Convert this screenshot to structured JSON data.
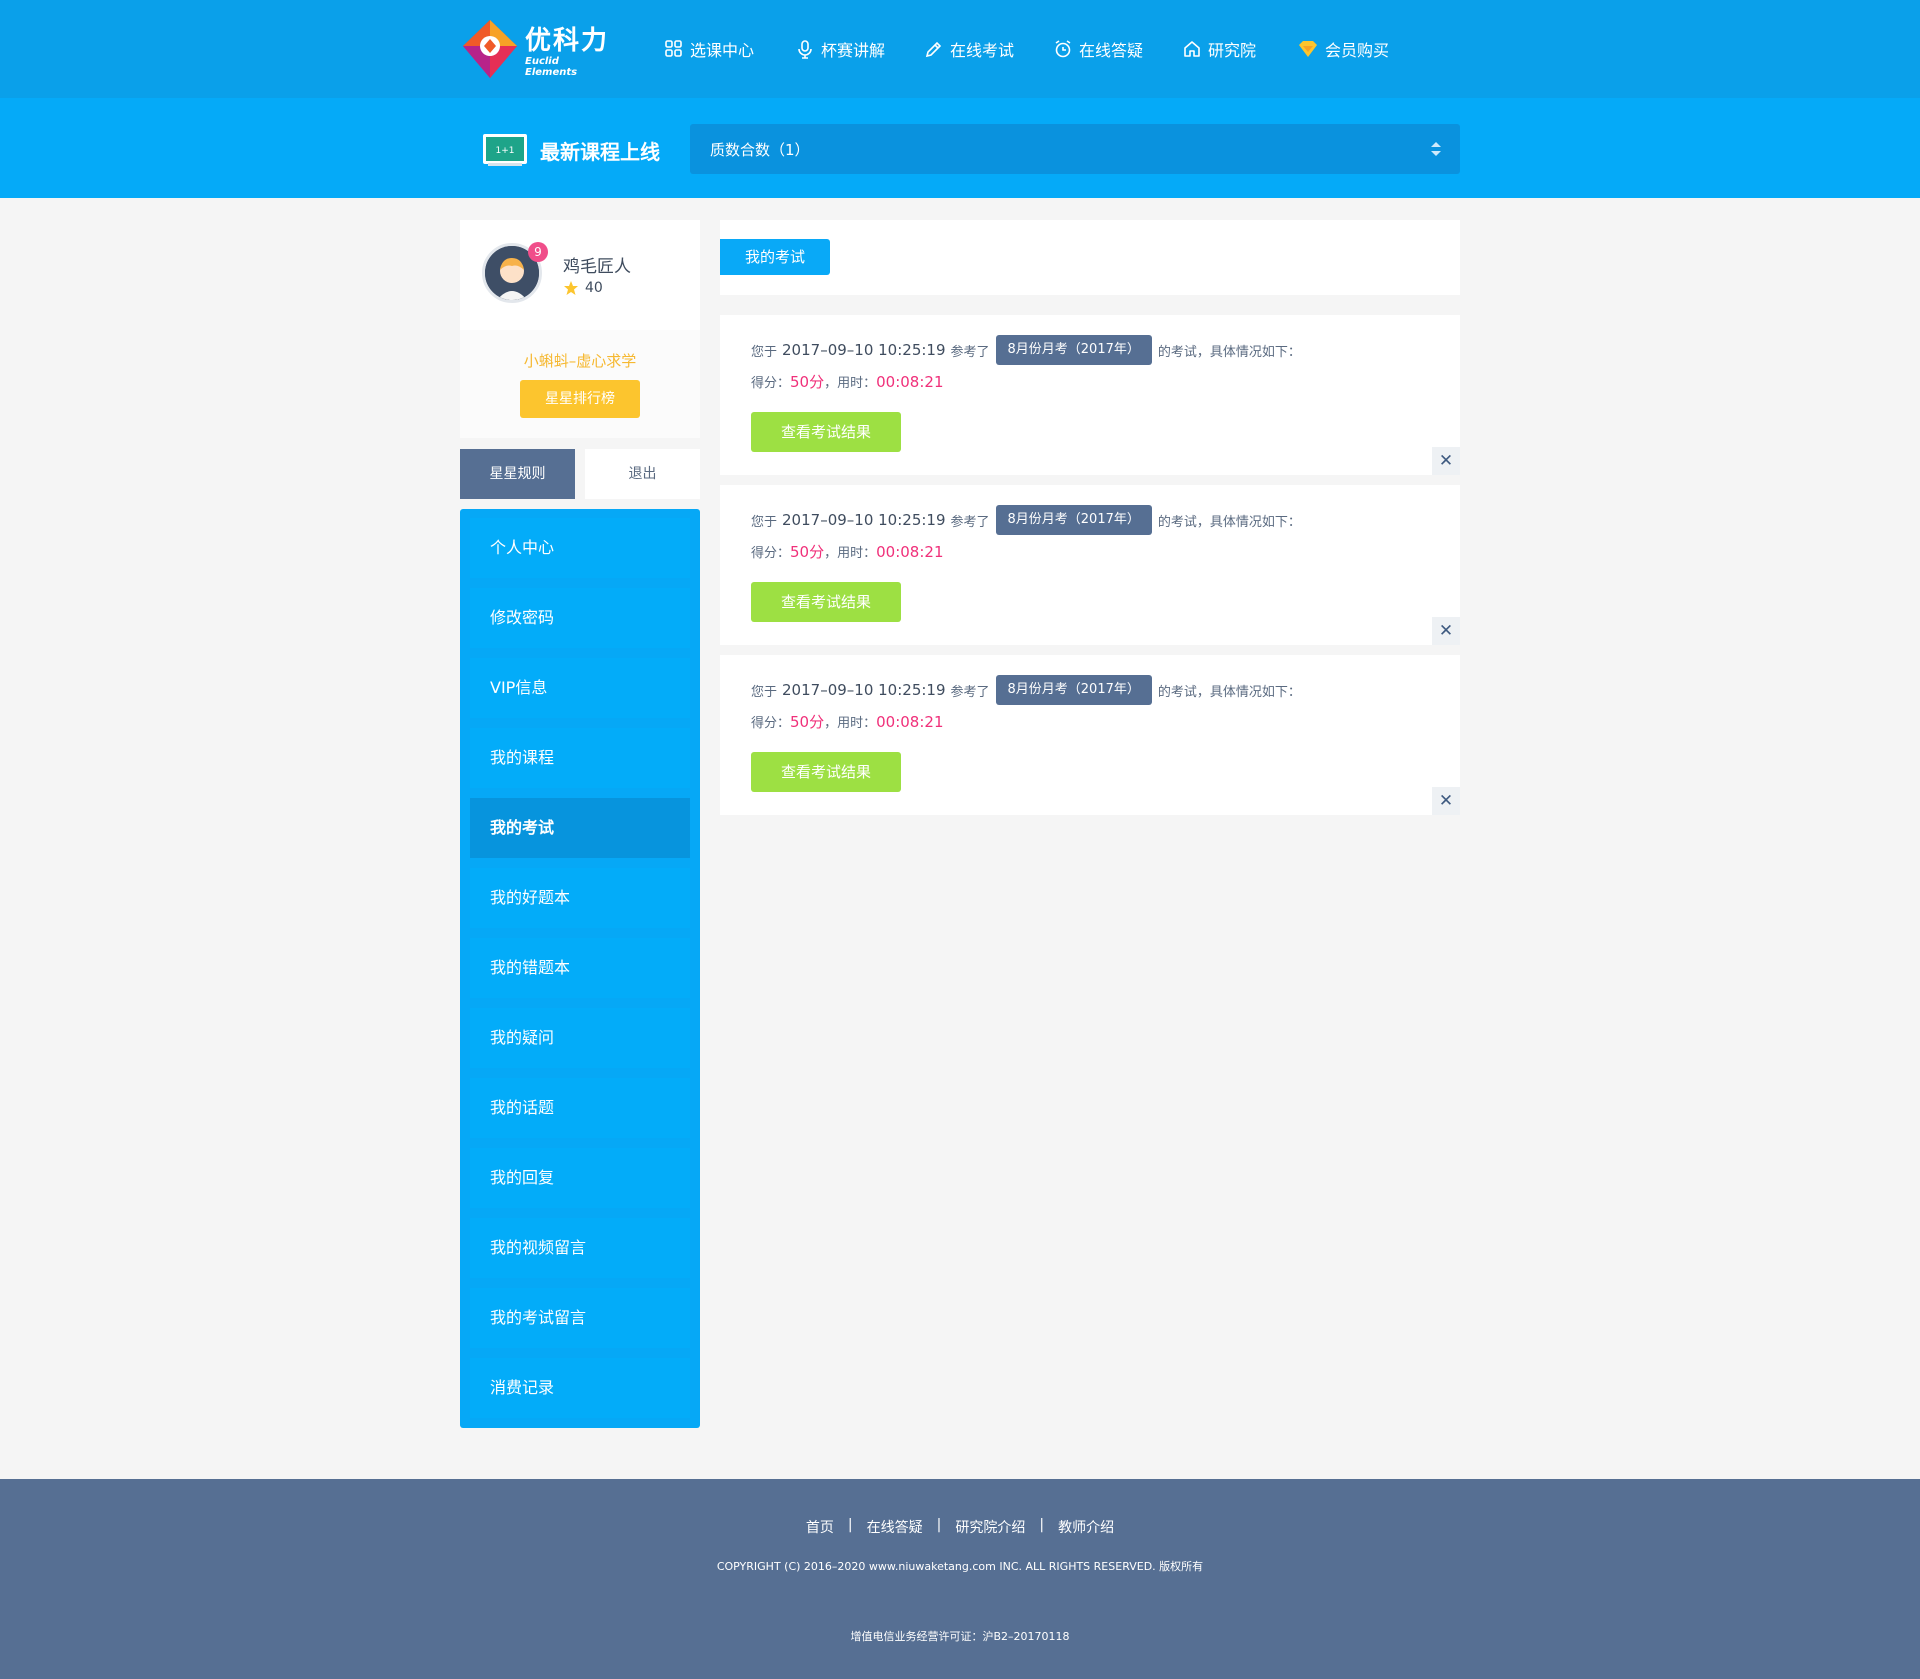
{
  "brand": {
    "name": "优科力",
    "subtitle": "Euclid Elements"
  },
  "nav": [
    {
      "label": "选课中心",
      "icon": "grid-icon"
    },
    {
      "label": "杯赛讲解",
      "icon": "microphone-icon"
    },
    {
      "label": "在线考试",
      "icon": "pencil-icon"
    },
    {
      "label": "在线答疑",
      "icon": "alarm-clock-icon"
    },
    {
      "label": "研究院",
      "icon": "home-icon"
    },
    {
      "label": "会员购买",
      "icon": "diamond-icon"
    }
  ],
  "banner": {
    "title": "最新课程上线",
    "board_text": "1+1",
    "selected_course": "质数合数（1）"
  },
  "profile": {
    "username": "鸡毛匠人",
    "notifications": "9",
    "stars": "40",
    "rank_title": "小蝌蚪–虚心求学",
    "rank_button": "星星排行榜",
    "rules_button": "星星规则",
    "logout_button": "退出"
  },
  "menu": [
    {
      "label": "个人中心",
      "active": false
    },
    {
      "label": "修改密码",
      "active": false
    },
    {
      "label": "VIP信息",
      "active": false
    },
    {
      "label": "我的课程",
      "active": false
    },
    {
      "label": "我的考试",
      "active": true
    },
    {
      "label": "我的好题本",
      "active": false
    },
    {
      "label": "我的错题本",
      "active": false
    },
    {
      "label": "我的疑问",
      "active": false
    },
    {
      "label": "我的话题",
      "active": false
    },
    {
      "label": "我的回复",
      "active": false
    },
    {
      "label": "我的视频留言",
      "active": false
    },
    {
      "label": "我的考试留言",
      "active": false
    },
    {
      "label": "消费记录",
      "active": false
    }
  ],
  "main": {
    "tab": "我的考试",
    "records": [
      {
        "prefix": "您于",
        "datetime": "2017–09–10 10:25:19",
        "mid": "参考了",
        "exam": "8月份月考（2017年）",
        "suffix": "的考试，具体情况如下：",
        "score_label": "得分：",
        "score": "50分",
        "time_label": "，用时：",
        "time": "00:08:21",
        "button": "查看考试结果",
        "close": "✕"
      },
      {
        "prefix": "您于",
        "datetime": "2017–09–10 10:25:19",
        "mid": "参考了",
        "exam": "8月份月考（2017年）",
        "suffix": "的考试，具体情况如下：",
        "score_label": "得分：",
        "score": "50分",
        "time_label": "，用时：",
        "time": "00:08:21",
        "button": "查看考试结果",
        "close": "✕"
      },
      {
        "prefix": "您于",
        "datetime": "2017–09–10 10:25:19",
        "mid": "参考了",
        "exam": "8月份月考（2017年）",
        "suffix": "的考试，具体情况如下：",
        "score_label": "得分：",
        "score": "50分",
        "time_label": "，用时：",
        "time": "00:08:21",
        "button": "查看考试结果",
        "close": "✕"
      }
    ]
  },
  "footer": {
    "links": [
      "首页",
      "在线答疑",
      "研究院介绍",
      "教师介绍"
    ],
    "separator": "|",
    "copyright": "COPYRIGHT (C) 2016–2020 www.niuwaketang.com INC. ALL RIGHTS RESERVED. 版权所有",
    "license": "增值电信业务经营许可证：沪B2–20170118"
  },
  "colors": {
    "nav_bg": "#0aa0ea",
    "banner_bg": "#05aaf8",
    "accent_pink": "#f0307a",
    "button_green": "#9de043",
    "button_yellow": "#fcc52e",
    "slate": "#566f93"
  }
}
